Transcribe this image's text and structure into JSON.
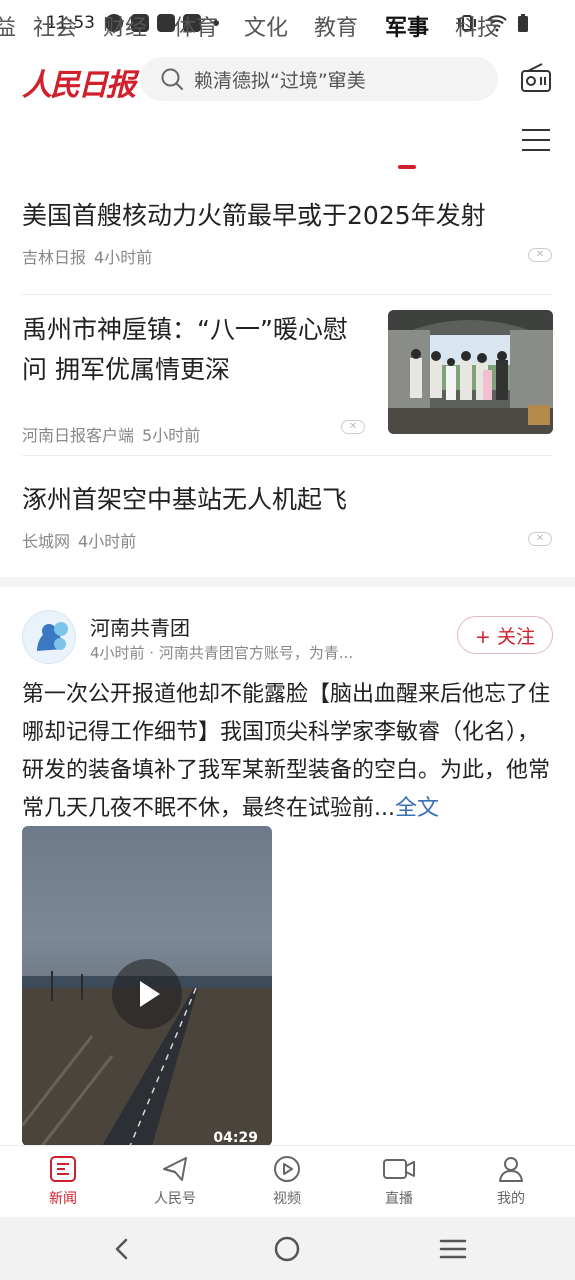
{
  "status_bar": {
    "time": "11:53"
  },
  "header": {
    "logo_text": "人民日报",
    "search_placeholder": "赖清德拟“过境”窜美"
  },
  "tabs": [
    {
      "label": "益"
    },
    {
      "label": "社会"
    },
    {
      "label": "财经"
    },
    {
      "label": "体育"
    },
    {
      "label": "文化"
    },
    {
      "label": "教育"
    },
    {
      "label": "军事"
    },
    {
      "label": "科技"
    }
  ],
  "news": [
    {
      "title": "美国首艘核动力火箭最早或于2025年发射",
      "source": "吉林日报",
      "time": "4小时前"
    },
    {
      "title": "禹州市神垕镇：“八一”暖心慰问 拥军优属情更深",
      "source": "河南日报客户端",
      "time": "5小时前"
    },
    {
      "title": "涿州首架空中基站无人机起飞",
      "source": "长城网",
      "time": "4小时前"
    }
  ],
  "post": {
    "account_name": "河南共青团",
    "account_sub": "4小时前 · 河南共青团官方账号，为青...",
    "follow_label": "+ 关注",
    "text": "第一次公开报道他却不能露脸【脑出血醒来后他忘了住哪却记得工作细节】我国顶尖科学家李敏睿（化名），研发的装备填补了我军某新型装备的空白。为此，他常常几天几夜不眠不休，最终在试验前...",
    "more_label": "全文",
    "video_duration": "04:29"
  },
  "bottom_nav": [
    {
      "label": "新闻",
      "icon": "news-icon"
    },
    {
      "label": "人民号",
      "icon": "send-icon"
    },
    {
      "label": "视频",
      "icon": "video-icon"
    },
    {
      "label": "直播",
      "icon": "live-camera-icon"
    },
    {
      "label": "我的",
      "icon": "profile-icon"
    }
  ],
  "colors": {
    "accent": "#d11f2b",
    "link": "#3b6fb6"
  }
}
